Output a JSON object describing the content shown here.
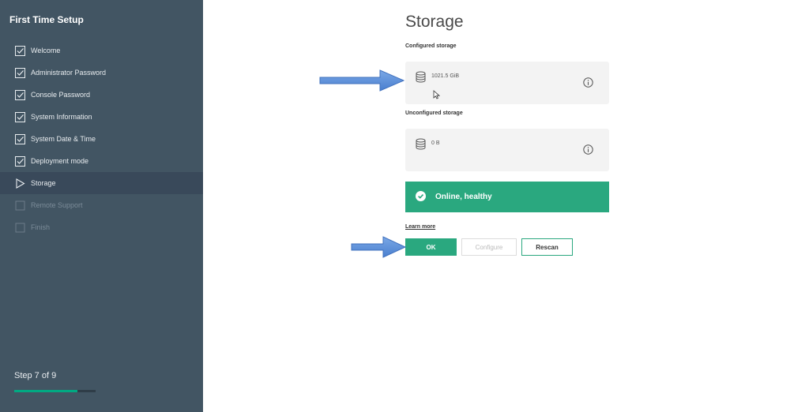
{
  "sidebar": {
    "title": "First Time Setup",
    "steps": [
      {
        "label": "Welcome",
        "state": "completed"
      },
      {
        "label": "Administrator Password",
        "state": "completed"
      },
      {
        "label": "Console Password",
        "state": "completed"
      },
      {
        "label": "System Information",
        "state": "completed"
      },
      {
        "label": "System Date & Time",
        "state": "completed"
      },
      {
        "label": "Deployment mode",
        "state": "completed"
      },
      {
        "label": "Storage",
        "state": "active"
      },
      {
        "label": "Remote Support",
        "state": "disabled"
      },
      {
        "label": "Finish",
        "state": "disabled"
      }
    ],
    "step_text": "Step 7 of 9",
    "progress_fraction": 0.78
  },
  "main": {
    "title": "Storage",
    "configured": {
      "label": "Configured storage",
      "value": "1021.5 GiB"
    },
    "unconfigured": {
      "label": "Unconfigured storage",
      "value": "0 B"
    },
    "status": {
      "text": "Online, healthy"
    },
    "learn_more": "Learn more",
    "buttons": {
      "ok": "OK",
      "configure": "Configure",
      "rescan": "Rescan"
    }
  },
  "colors": {
    "sidebar_bg": "#425563",
    "sidebar_active_bg": "#39495a",
    "accent_green": "#2aa87f",
    "annotation_arrow": "#5b8fd6"
  },
  "icons": {
    "completed_step": "checkbox-checked-icon",
    "active_step": "play-triangle-icon",
    "disabled_step": "checkbox-empty-icon",
    "storage": "database-icon",
    "info": "info-circle-icon",
    "status": "check-circle-icon"
  }
}
